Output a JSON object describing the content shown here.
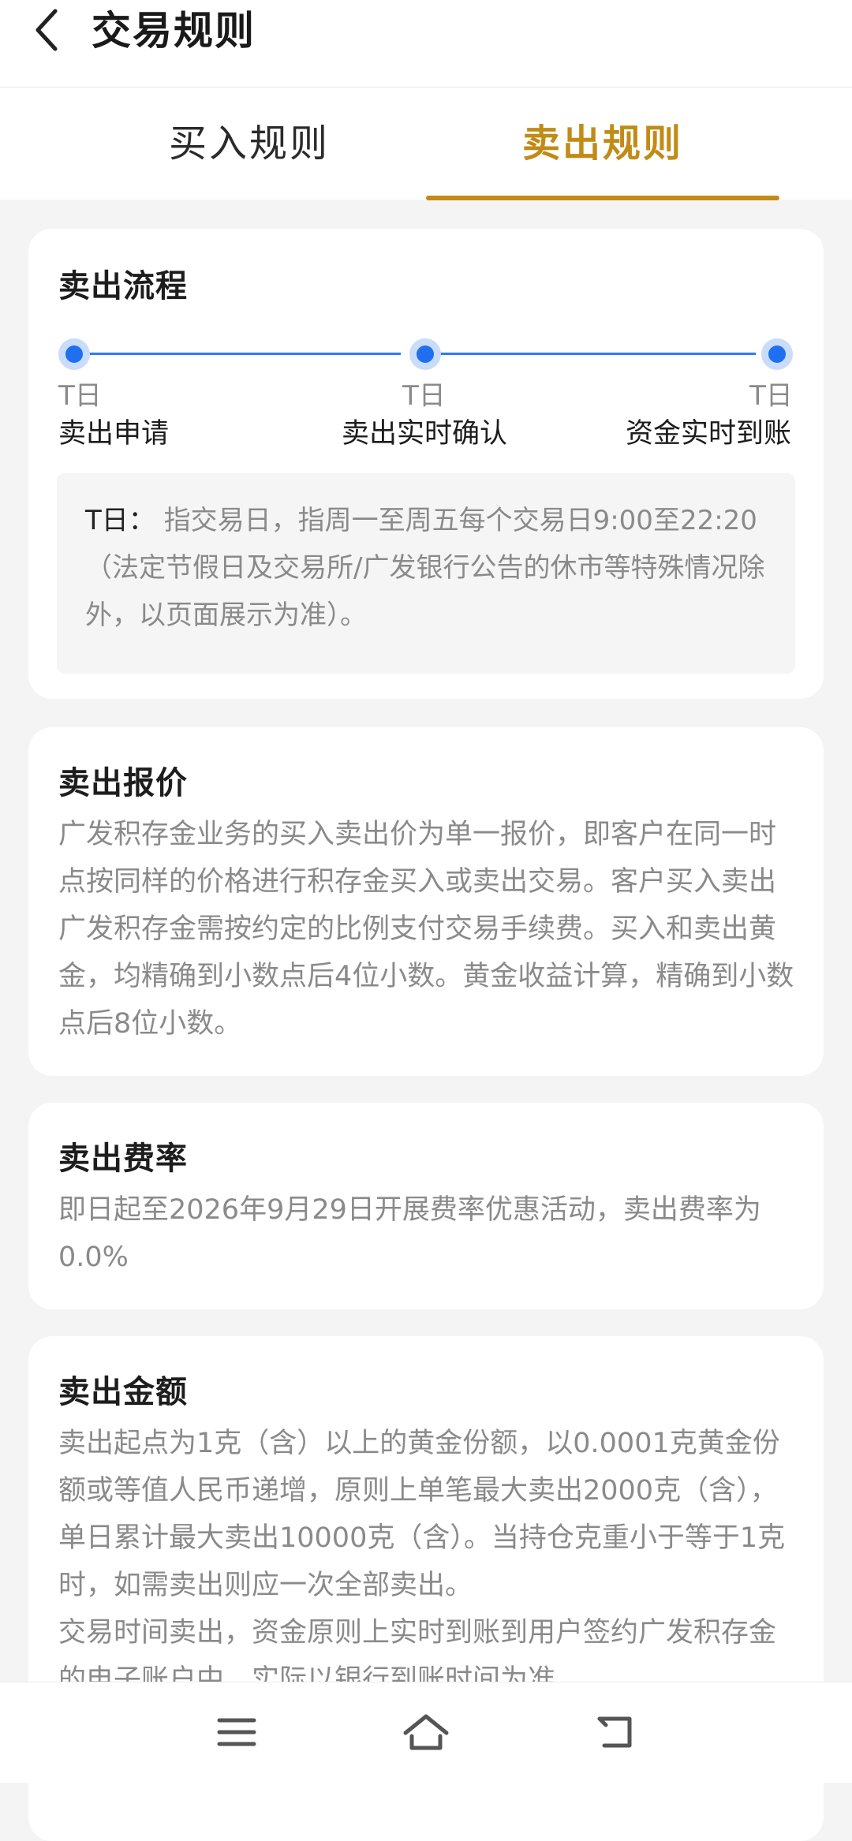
{
  "header": {
    "title": "交易规则"
  },
  "tabs": [
    {
      "label": "买入规则",
      "active": false
    },
    {
      "label": "卖出规则",
      "active": true
    }
  ],
  "process": {
    "title": "卖出流程",
    "steps": [
      {
        "day": "T日",
        "label": "卖出申请"
      },
      {
        "day": "T日",
        "label": "卖出实时确认"
      },
      {
        "day": "T日",
        "label": "资金实时到账"
      }
    ],
    "note_term": "T日：",
    "note_text": "指交易日，指周一至周五每个交易日9:00至22:20（法定节假日及交易所/广发银行公告的休市等特殊情况除外，以页面展示为准）。"
  },
  "quote": {
    "title": "卖出报价",
    "body": "广发积存金业务的买入卖出价为单一报价，即客户在同一时点按同样的价格进行积存金买入或卖出交易。客户买入卖出广发积存金需按约定的比例支付交易手续费。买入和卖出黄金，均精确到小数点后4位小数。黄金收益计算，精确到小数点后8位小数。"
  },
  "fee": {
    "title": "卖出费率",
    "body": "即日起至2026年9月29日开展费率优惠活动，卖出费率为0.0%"
  },
  "amount": {
    "title": "卖出金额",
    "body1": "卖出起点为1克（含）以上的黄金份额，以0.0001克黄金份额或等值人民币递增，原则上单笔最大卖出2000克（含），单日累计最大卖出10000克（含）。当持仓克重小于等于1克时，如需卖出则应一次全部卖出。",
    "body2": "交易时间卖出，资金原则上实时到账到用户签约广发积存金的电子账户中，实际以银行到账时间为准。"
  },
  "colors": {
    "accent": "#c18b16",
    "progress": "#1f6ff0"
  },
  "icons": {
    "back": "chevron-left-icon",
    "menu": "menu-icon",
    "home": "home-icon",
    "return": "return-icon"
  }
}
